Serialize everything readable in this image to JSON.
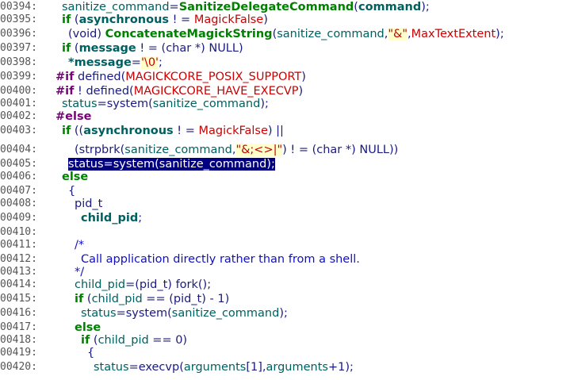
{
  "lines": [
    {
      "no": "00394:",
      "parts": [
        [
          "id",
          "sanitize_command"
        ],
        [
          "plain",
          "="
        ],
        [
          "fn",
          "SanitizeDelegateCommand"
        ],
        [
          "plain",
          "("
        ],
        [
          "var",
          "command"
        ],
        [
          "plain",
          ");"
        ]
      ]
    },
    {
      "no": "00395:",
      "parts": [
        [
          "kw",
          "if"
        ],
        [
          "plain",
          " ("
        ],
        [
          "var",
          "asynchronous"
        ],
        [
          "plain",
          " ! = "
        ],
        [
          "const",
          "MagickFalse"
        ],
        [
          "plain",
          ")"
        ]
      ]
    },
    {
      "no": "00396:",
      "parts": [
        [
          "plain",
          "(void) "
        ],
        [
          "fn",
          "ConcatenateMagickString"
        ],
        [
          "plain",
          "("
        ],
        [
          "id",
          "sanitize_command"
        ],
        [
          "plain",
          ","
        ],
        [
          "str",
          "\"&\""
        ],
        [
          "plain",
          ","
        ],
        [
          "const",
          "MaxTextExtent"
        ],
        [
          "plain",
          ");"
        ]
      ]
    },
    {
      "no": "00397:",
      "parts": [
        [
          "kw",
          "if"
        ],
        [
          "plain",
          " ("
        ],
        [
          "var",
          "message"
        ],
        [
          "plain",
          " ! = (char *) NULL)"
        ]
      ]
    },
    {
      "no": "00398:",
      "parts": [
        [
          "var",
          "*message"
        ],
        [
          "plain",
          "="
        ],
        [
          "str",
          "'\\0'"
        ],
        [
          "plain",
          ";"
        ]
      ]
    },
    {
      "no": "00399:",
      "parts": [
        [
          "pp",
          "#if"
        ],
        [
          "plain",
          " defined("
        ],
        [
          "ppid",
          "MAGICKCORE_POSIX_SUPPORT"
        ],
        [
          "plain",
          ")"
        ]
      ]
    },
    {
      "no": "00400:",
      "parts": [
        [
          "pp",
          "#if"
        ],
        [
          "plain",
          " ! defined("
        ],
        [
          "ppid",
          "MAGICKCORE_HAVE_EXECVP"
        ],
        [
          "plain",
          ")"
        ]
      ]
    },
    {
      "no": "00401:",
      "parts": [
        [
          "id",
          "status"
        ],
        [
          "plain",
          "=system("
        ],
        [
          "id",
          "sanitize_command"
        ],
        [
          "plain",
          ");"
        ]
      ]
    },
    {
      "no": "00402:",
      "parts": [
        [
          "pp",
          "#else"
        ]
      ]
    },
    {
      "no": "00403:",
      "parts": [
        [
          "kw",
          "if"
        ],
        [
          "plain",
          " (("
        ],
        [
          "var",
          "asynchronous"
        ],
        [
          "plain",
          " ! = "
        ],
        [
          "const",
          "MagickFalse"
        ],
        [
          "plain",
          ") ||"
        ]
      ]
    },
    {
      "no": "00404:",
      "parts": [
        [
          "plain",
          "(strpbrk("
        ],
        [
          "id",
          "sanitize_command"
        ],
        [
          "plain",
          ","
        ],
        [
          "str",
          "\"&;<>|\""
        ],
        [
          "plain",
          ") ! = (char *) NULL))"
        ]
      ]
    },
    {
      "no": "00405:",
      "parts": [
        [
          "hl",
          "status=system(sanitize_command);"
        ]
      ]
    },
    {
      "no": "00406:",
      "parts": [
        [
          "kw",
          "else"
        ]
      ]
    },
    {
      "no": "00407:",
      "parts": [
        [
          "plain",
          "{"
        ]
      ]
    },
    {
      "no": "00408:",
      "parts": [
        [
          "type",
          "pid_t"
        ]
      ]
    },
    {
      "no": "00409:",
      "parts": [
        [
          "var",
          "child_pid"
        ],
        [
          "plain",
          ";"
        ]
      ]
    },
    {
      "no": "00410:",
      "parts": []
    },
    {
      "no": "00411:",
      "parts": [
        [
          "cm",
          "/*"
        ]
      ]
    },
    {
      "no": "00412:",
      "parts": [
        [
          "cm",
          "Call application directly rather than from a shell."
        ]
      ]
    },
    {
      "no": "00413:",
      "parts": [
        [
          "cm",
          "*/"
        ]
      ]
    },
    {
      "no": "00414:",
      "parts": [
        [
          "id",
          "child_pid"
        ],
        [
          "plain",
          "=(pid_t) fork();"
        ]
      ]
    },
    {
      "no": "00415:",
      "parts": [
        [
          "kw",
          "if"
        ],
        [
          "plain",
          " ("
        ],
        [
          "id",
          "child_pid"
        ],
        [
          "plain",
          " == (pid_t) - 1)"
        ]
      ]
    },
    {
      "no": "00416:",
      "parts": [
        [
          "id",
          "status"
        ],
        [
          "plain",
          "=system("
        ],
        [
          "id",
          "sanitize_command"
        ],
        [
          "plain",
          ");"
        ]
      ]
    },
    {
      "no": "00417:",
      "parts": [
        [
          "kw",
          "else"
        ]
      ]
    },
    {
      "no": "00418:",
      "parts": [
        [
          "kw",
          "if"
        ],
        [
          "plain",
          " ("
        ],
        [
          "id",
          "child_pid"
        ],
        [
          "plain",
          " == 0)"
        ]
      ]
    },
    {
      "no": "00419:",
      "parts": [
        [
          "plain",
          "{"
        ]
      ]
    },
    {
      "no": "00420:",
      "parts": [
        [
          "id",
          "status"
        ],
        [
          "plain",
          "=execvp("
        ],
        [
          "id",
          "arguments"
        ],
        [
          "plain",
          "[1],"
        ],
        [
          "id",
          "arguments"
        ],
        [
          "plain",
          "+1);"
        ]
      ]
    }
  ]
}
